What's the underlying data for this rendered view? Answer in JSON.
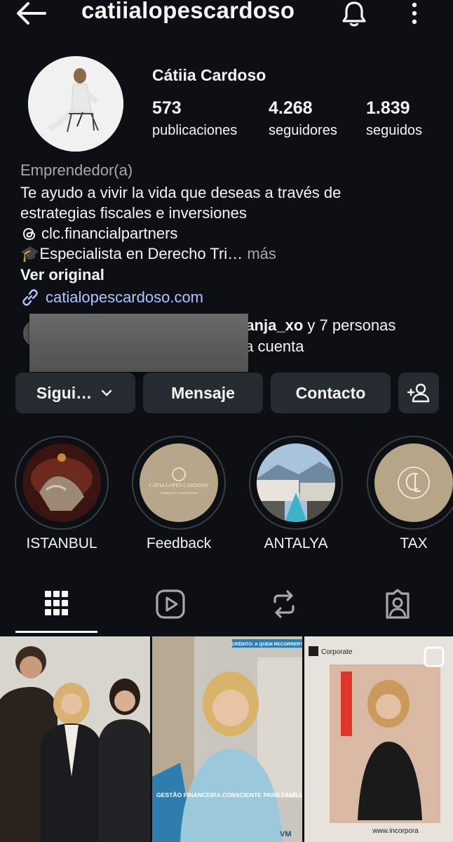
{
  "header": {
    "username": "catiialopescardoso"
  },
  "profile": {
    "display_name": "Cátiia Cardoso",
    "stats": [
      {
        "value": "573",
        "label": "publicaciones"
      },
      {
        "value": "4.268",
        "label": "seguidores"
      },
      {
        "value": "1.839",
        "label": "seguidos"
      }
    ],
    "category": "Emprendedor(a)",
    "bio_lines": [
      "Te ayudo a vivir la vida que deseas a través de",
      "estrategias fiscales e inversiones",
      "clc.financialpartners",
      "🎓Especialista en Derecho Tri…"
    ],
    "more_label": "más",
    "translate_label": "Ver original",
    "website": "catialopescardoso.com",
    "mutual_name": "tanja_xo",
    "mutual_rest": " y 7 personas",
    "mutual_line2": "ta cuenta"
  },
  "actions": {
    "follow_label": "Sigui…",
    "message_label": "Mensaje",
    "contact_label": "Contacto"
  },
  "highlights": [
    {
      "label": "ISTANBUL"
    },
    {
      "label": "Feedback"
    },
    {
      "label": "ANTALYA"
    },
    {
      "label": "TAX"
    }
  ],
  "highlight_art": {
    "feedback_brand": "CATIA LOPES CARDOSO",
    "feedback_sub": "FINANÇAS E CONSULTORIA"
  },
  "posts": [
    {
      "id": "post-1"
    },
    {
      "id": "post-2",
      "badge": "CRÉDITO: A QUEM RECORRER?",
      "caption": "GESTÃO FINANCEIRA CONSCIENTE PARA FAMÍLIAS E EMPRESAS",
      "logo": "VM"
    },
    {
      "id": "post-3",
      "brand": "Corporate",
      "url": "www.incorpora"
    }
  ],
  "colors": {
    "background": "#0c1014",
    "button": "#262a31",
    "link": "#b5c2ff",
    "muted": "#a8a8a8"
  }
}
